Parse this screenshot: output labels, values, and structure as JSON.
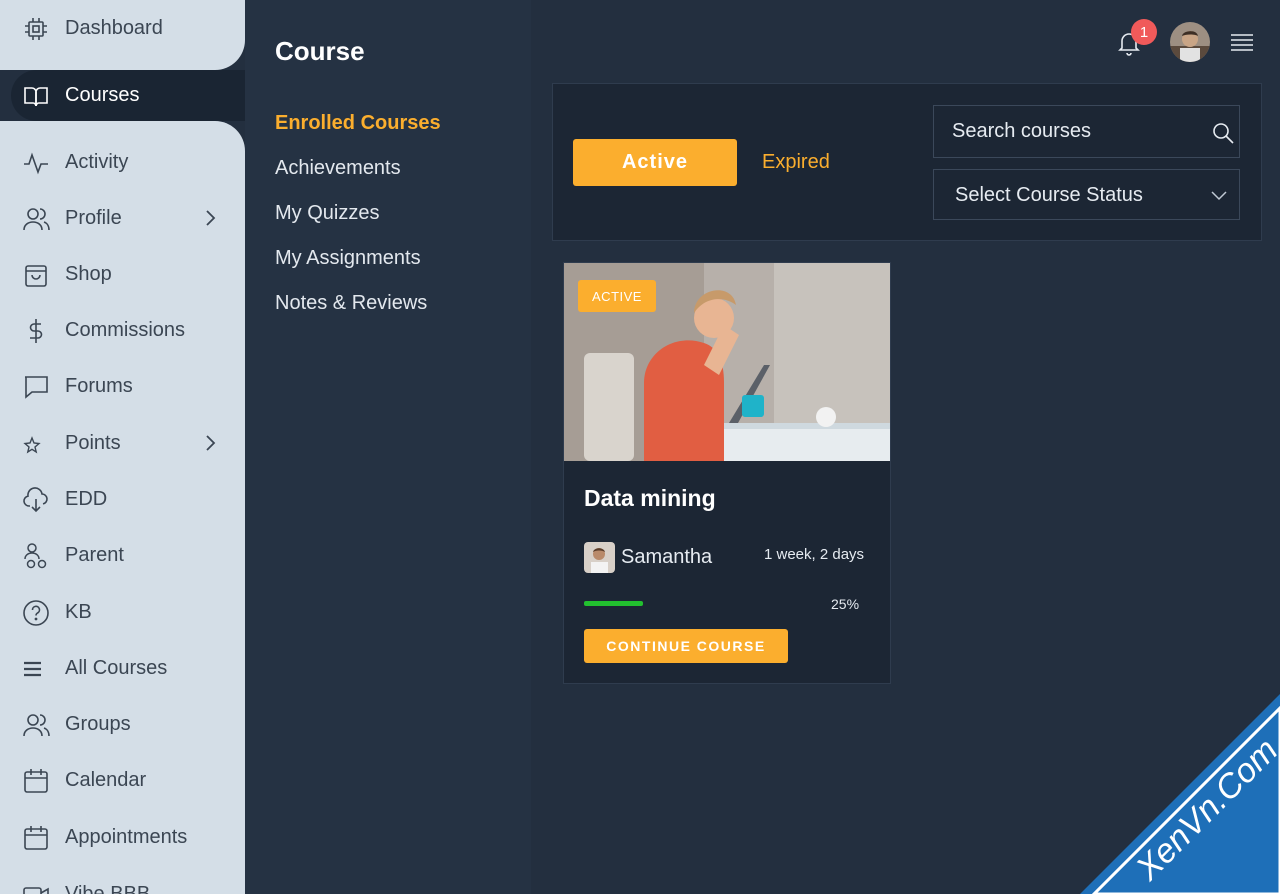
{
  "sidebar": {
    "items": [
      {
        "label": "Dashboard",
        "icon": "chip-icon"
      },
      {
        "label": "Courses",
        "icon": "book-icon",
        "active": true
      },
      {
        "label": "Activity",
        "icon": "activity-icon"
      },
      {
        "label": "Profile",
        "icon": "users-icon",
        "has_submenu": true
      },
      {
        "label": "Shop",
        "icon": "shopping-bag-icon"
      },
      {
        "label": "Commissions",
        "icon": "dollar-icon"
      },
      {
        "label": "Forums",
        "icon": "chat-icon"
      },
      {
        "label": "Points",
        "icon": "star-icon",
        "has_submenu": true
      },
      {
        "label": "EDD",
        "icon": "cloud-download-icon"
      },
      {
        "label": "Parent",
        "icon": "parent-icon"
      },
      {
        "label": "KB",
        "icon": "help-icon"
      },
      {
        "label": "All Courses",
        "icon": "list-icon"
      },
      {
        "label": "Groups",
        "icon": "users-icon"
      },
      {
        "label": "Calendar",
        "icon": "calendar-icon"
      },
      {
        "label": "Appointments",
        "icon": "calendar-icon"
      },
      {
        "label": "Vibe BBB",
        "icon": "video-icon"
      }
    ]
  },
  "subnav": {
    "title": "Course",
    "items": [
      {
        "label": "Enrolled Courses",
        "active": true
      },
      {
        "label": "Achievements"
      },
      {
        "label": "My Quizzes"
      },
      {
        "label": "My Assignments"
      },
      {
        "label": "Notes & Reviews"
      }
    ]
  },
  "topbar": {
    "notification_count": "1"
  },
  "filters": {
    "active_label": "Active",
    "expired_label": "Expired",
    "search_placeholder": "Search courses",
    "status_select": "Select Course Status"
  },
  "courses": [
    {
      "status": "ACTIVE",
      "title": "Data mining",
      "author": "Samantha",
      "duration": "1 week, 2 days",
      "progress_label": "25%",
      "progress": 0.25,
      "cta": "CONTINUE COURSE"
    }
  ],
  "watermark": "XenVn.Com",
  "colors": {
    "accent": "#fbae2e",
    "background": "#232f3f",
    "sidebar": "#d4dee7",
    "progress": "#22c02f",
    "badge": "#f05a5a"
  }
}
